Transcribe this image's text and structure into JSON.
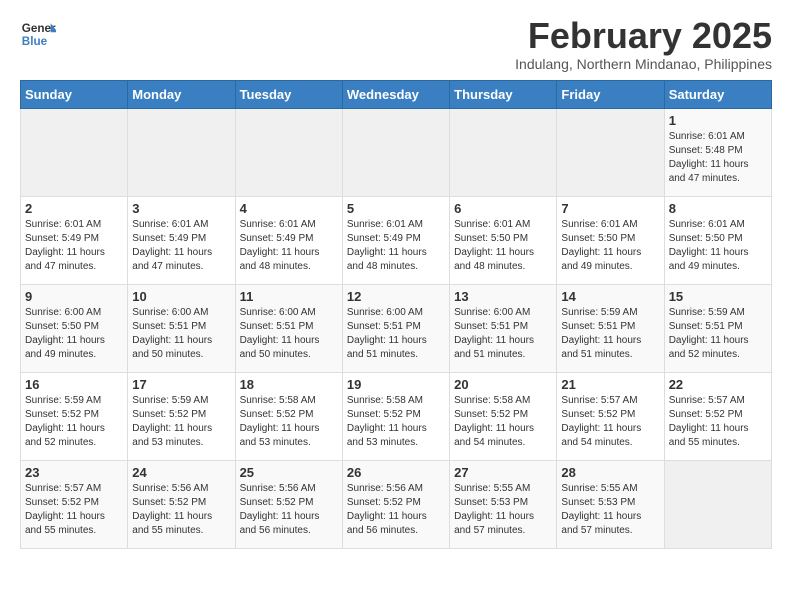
{
  "logo": {
    "line1": "General",
    "line2": "Blue"
  },
  "title": "February 2025",
  "subtitle": "Indulang, Northern Mindanao, Philippines",
  "weekdays": [
    "Sunday",
    "Monday",
    "Tuesday",
    "Wednesday",
    "Thursday",
    "Friday",
    "Saturday"
  ],
  "rows": [
    [
      {
        "day": "",
        "info": ""
      },
      {
        "day": "",
        "info": ""
      },
      {
        "day": "",
        "info": ""
      },
      {
        "day": "",
        "info": ""
      },
      {
        "day": "",
        "info": ""
      },
      {
        "day": "",
        "info": ""
      },
      {
        "day": "1",
        "info": "Sunrise: 6:01 AM\nSunset: 5:48 PM\nDaylight: 11 hours\nand 47 minutes."
      }
    ],
    [
      {
        "day": "2",
        "info": "Sunrise: 6:01 AM\nSunset: 5:49 PM\nDaylight: 11 hours\nand 47 minutes."
      },
      {
        "day": "3",
        "info": "Sunrise: 6:01 AM\nSunset: 5:49 PM\nDaylight: 11 hours\nand 47 minutes."
      },
      {
        "day": "4",
        "info": "Sunrise: 6:01 AM\nSunset: 5:49 PM\nDaylight: 11 hours\nand 48 minutes."
      },
      {
        "day": "5",
        "info": "Sunrise: 6:01 AM\nSunset: 5:49 PM\nDaylight: 11 hours\nand 48 minutes."
      },
      {
        "day": "6",
        "info": "Sunrise: 6:01 AM\nSunset: 5:50 PM\nDaylight: 11 hours\nand 48 minutes."
      },
      {
        "day": "7",
        "info": "Sunrise: 6:01 AM\nSunset: 5:50 PM\nDaylight: 11 hours\nand 49 minutes."
      },
      {
        "day": "8",
        "info": "Sunrise: 6:01 AM\nSunset: 5:50 PM\nDaylight: 11 hours\nand 49 minutes."
      }
    ],
    [
      {
        "day": "9",
        "info": "Sunrise: 6:00 AM\nSunset: 5:50 PM\nDaylight: 11 hours\nand 49 minutes."
      },
      {
        "day": "10",
        "info": "Sunrise: 6:00 AM\nSunset: 5:51 PM\nDaylight: 11 hours\nand 50 minutes."
      },
      {
        "day": "11",
        "info": "Sunrise: 6:00 AM\nSunset: 5:51 PM\nDaylight: 11 hours\nand 50 minutes."
      },
      {
        "day": "12",
        "info": "Sunrise: 6:00 AM\nSunset: 5:51 PM\nDaylight: 11 hours\nand 51 minutes."
      },
      {
        "day": "13",
        "info": "Sunrise: 6:00 AM\nSunset: 5:51 PM\nDaylight: 11 hours\nand 51 minutes."
      },
      {
        "day": "14",
        "info": "Sunrise: 5:59 AM\nSunset: 5:51 PM\nDaylight: 11 hours\nand 51 minutes."
      },
      {
        "day": "15",
        "info": "Sunrise: 5:59 AM\nSunset: 5:51 PM\nDaylight: 11 hours\nand 52 minutes."
      }
    ],
    [
      {
        "day": "16",
        "info": "Sunrise: 5:59 AM\nSunset: 5:52 PM\nDaylight: 11 hours\nand 52 minutes."
      },
      {
        "day": "17",
        "info": "Sunrise: 5:59 AM\nSunset: 5:52 PM\nDaylight: 11 hours\nand 53 minutes."
      },
      {
        "day": "18",
        "info": "Sunrise: 5:58 AM\nSunset: 5:52 PM\nDaylight: 11 hours\nand 53 minutes."
      },
      {
        "day": "19",
        "info": "Sunrise: 5:58 AM\nSunset: 5:52 PM\nDaylight: 11 hours\nand 53 minutes."
      },
      {
        "day": "20",
        "info": "Sunrise: 5:58 AM\nSunset: 5:52 PM\nDaylight: 11 hours\nand 54 minutes."
      },
      {
        "day": "21",
        "info": "Sunrise: 5:57 AM\nSunset: 5:52 PM\nDaylight: 11 hours\nand 54 minutes."
      },
      {
        "day": "22",
        "info": "Sunrise: 5:57 AM\nSunset: 5:52 PM\nDaylight: 11 hours\nand 55 minutes."
      }
    ],
    [
      {
        "day": "23",
        "info": "Sunrise: 5:57 AM\nSunset: 5:52 PM\nDaylight: 11 hours\nand 55 minutes."
      },
      {
        "day": "24",
        "info": "Sunrise: 5:56 AM\nSunset: 5:52 PM\nDaylight: 11 hours\nand 55 minutes."
      },
      {
        "day": "25",
        "info": "Sunrise: 5:56 AM\nSunset: 5:52 PM\nDaylight: 11 hours\nand 56 minutes."
      },
      {
        "day": "26",
        "info": "Sunrise: 5:56 AM\nSunset: 5:52 PM\nDaylight: 11 hours\nand 56 minutes."
      },
      {
        "day": "27",
        "info": "Sunrise: 5:55 AM\nSunset: 5:53 PM\nDaylight: 11 hours\nand 57 minutes."
      },
      {
        "day": "28",
        "info": "Sunrise: 5:55 AM\nSunset: 5:53 PM\nDaylight: 11 hours\nand 57 minutes."
      },
      {
        "day": "",
        "info": ""
      }
    ]
  ]
}
